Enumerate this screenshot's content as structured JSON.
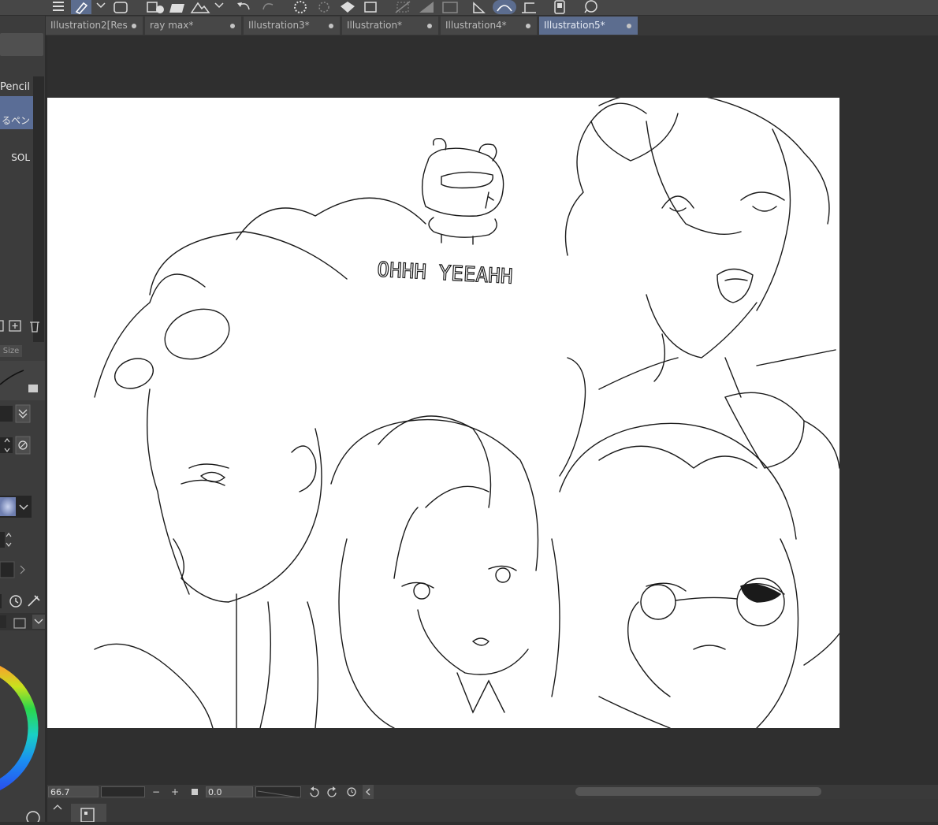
{
  "tabs": [
    {
      "label": "Illustration2[Res",
      "active": false
    },
    {
      "label": "ray max*",
      "active": false
    },
    {
      "label": "Illustration3*",
      "active": false
    },
    {
      "label": "Illustration*",
      "active": false
    },
    {
      "label": "Illustration4*",
      "active": false
    },
    {
      "label": "Illustration5*",
      "active": true
    }
  ],
  "left_panel": {
    "brushes": [
      {
        "label": "Pencil",
        "selected": false
      },
      {
        "label": "るペン",
        "selected": true
      },
      {
        "label": "SOL",
        "selected": false
      }
    ],
    "size_tab_label": "Size"
  },
  "canvas": {
    "handwritten_text": "OHHH YEEAHH"
  },
  "statusbar": {
    "zoom_value": "66.7",
    "rotation_value": "0.0",
    "zoom_out_label": "−",
    "zoom_in_label": "+"
  },
  "colors": {
    "active_tab": "#5c6d8f",
    "panel_bg": "#3c3c3c",
    "workspace_bg": "#2f2f2f",
    "canvas_bg": "#ffffff",
    "selected_brush": "#5a6d96"
  }
}
